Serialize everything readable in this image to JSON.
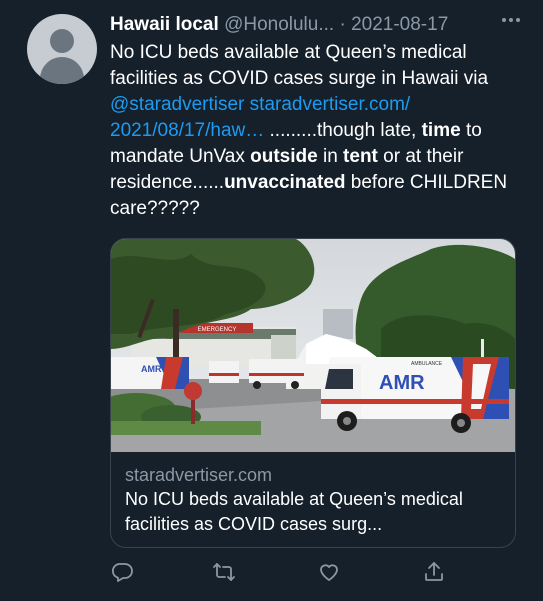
{
  "tweet": {
    "display_name": "Hawaii local",
    "handle": "@Honolulu...",
    "separator": "·",
    "date": "2021-08-17",
    "more_icon": "ellipsis-icon",
    "text": {
      "part1": "No ICU beds available at Queen’s medical facilities as COVID cases surge in Hawaii via ",
      "mention": "@staradvertiser",
      "space": " ",
      "url": "staradvertiser.com/ 2021/08/17/haw…",
      "part2": " .........though late, ",
      "b1": "time",
      "part3": " to mandate UnVax ",
      "b2": "outside",
      "part4": " in ",
      "b3": "tent",
      "part5": " or at their residence......",
      "b4": "unvaccinated",
      "part6": " before CHILDREN care?????"
    }
  },
  "card": {
    "image_alt": "Ambulances parked outside hospital emergency entrance",
    "ambulance_text": "AMR",
    "ambulance_label": "AMBULANCE",
    "sign_text": "EMERGENCY",
    "domain": "staradvertiser.com",
    "title": "No ICU beds available at Queen’s medical facilities as COVID cases surg..."
  },
  "actions": {
    "reply": "reply-icon",
    "retweet": "retweet-icon",
    "like": "heart-icon",
    "share": "share-icon"
  },
  "colors": {
    "background": "#15202b",
    "text": "#ffffff",
    "secondary": "#8b98a5",
    "link": "#1d9bf0",
    "border": "#38444d"
  }
}
